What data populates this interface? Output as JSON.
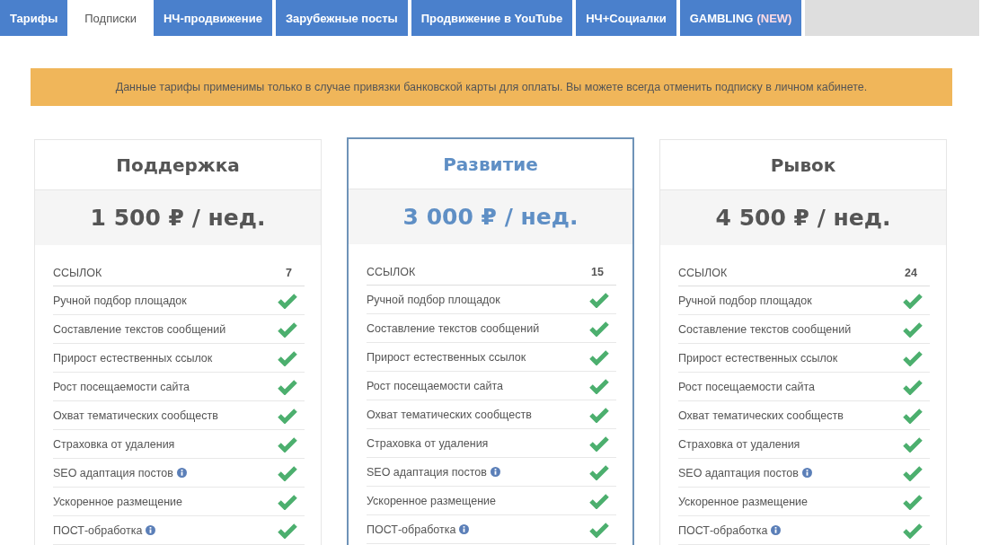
{
  "tabs": [
    {
      "label": "Тарифы",
      "selected": false
    },
    {
      "label": "Подписки",
      "selected": true
    },
    {
      "label": "НЧ-продвижение",
      "selected": false
    },
    {
      "label": "Зарубежные посты",
      "selected": false
    },
    {
      "label": "Продвижение в YouTube",
      "selected": false
    },
    {
      "label": "НЧ+Социалки",
      "selected": false
    },
    {
      "label": "GAMBLING",
      "badge": "(NEW)",
      "selected": false
    }
  ],
  "notice": "Данные тарифы применимы только в случае привязки банковской карты для оплаты. Вы можете всегда отменить подписку в личном кабинете.",
  "plans": [
    {
      "name": "Поддержка",
      "price": "1 500 ₽ / нед.",
      "selected": false,
      "links_label": "ССЫЛОК",
      "links_count": "7",
      "features": [
        {
          "label": "Ручной подбор площадок",
          "info": false,
          "included": true
        },
        {
          "label": "Составление текстов сообщений",
          "info": false,
          "included": true
        },
        {
          "label": "Прирост естественных ссылок",
          "info": false,
          "included": true
        },
        {
          "label": "Рост посещаемости сайта",
          "info": false,
          "included": true
        },
        {
          "label": "Охват тематических сообществ",
          "info": false,
          "included": true
        },
        {
          "label": "Страховка от удаления",
          "info": false,
          "included": true
        },
        {
          "label": "SEO адаптация постов",
          "info": true,
          "included": true
        },
        {
          "label": "Ускоренное размещение",
          "info": false,
          "included": true
        },
        {
          "label": "ПОСТ-обработка",
          "info": true,
          "included": true
        }
      ]
    },
    {
      "name": "Развитие",
      "price": "3 000 ₽ / нед.",
      "selected": true,
      "links_label": "ССЫЛОК",
      "links_count": "15",
      "features": [
        {
          "label": "Ручной подбор площадок",
          "info": false,
          "included": true
        },
        {
          "label": "Составление текстов сообщений",
          "info": false,
          "included": true
        },
        {
          "label": "Прирост естественных ссылок",
          "info": false,
          "included": true
        },
        {
          "label": "Рост посещаемости сайта",
          "info": false,
          "included": true
        },
        {
          "label": "Охват тематических сообществ",
          "info": false,
          "included": true
        },
        {
          "label": "Страховка от удаления",
          "info": false,
          "included": true
        },
        {
          "label": "SEO адаптация постов",
          "info": true,
          "included": true
        },
        {
          "label": "Ускоренное размещение",
          "info": false,
          "included": true
        },
        {
          "label": "ПОСТ-обработка",
          "info": true,
          "included": true
        }
      ]
    },
    {
      "name": "Рывок",
      "price": "4 500 ₽ / нед.",
      "selected": false,
      "links_label": "ССЫЛОК",
      "links_count": "24",
      "features": [
        {
          "label": "Ручной подбор площадок",
          "info": false,
          "included": true
        },
        {
          "label": "Составление текстов сообщений",
          "info": false,
          "included": true
        },
        {
          "label": "Прирост естественных ссылок",
          "info": false,
          "included": true
        },
        {
          "label": "Рост посещаемости сайта",
          "info": false,
          "included": true
        },
        {
          "label": "Охват тематических сообществ",
          "info": false,
          "included": true
        },
        {
          "label": "Страховка от удаления",
          "info": false,
          "included": true
        },
        {
          "label": "SEO адаптация постов",
          "info": true,
          "included": true
        },
        {
          "label": "Ускоренное размещение",
          "info": false,
          "included": true
        },
        {
          "label": "ПОСТ-обработка",
          "info": true,
          "included": true
        }
      ]
    }
  ]
}
